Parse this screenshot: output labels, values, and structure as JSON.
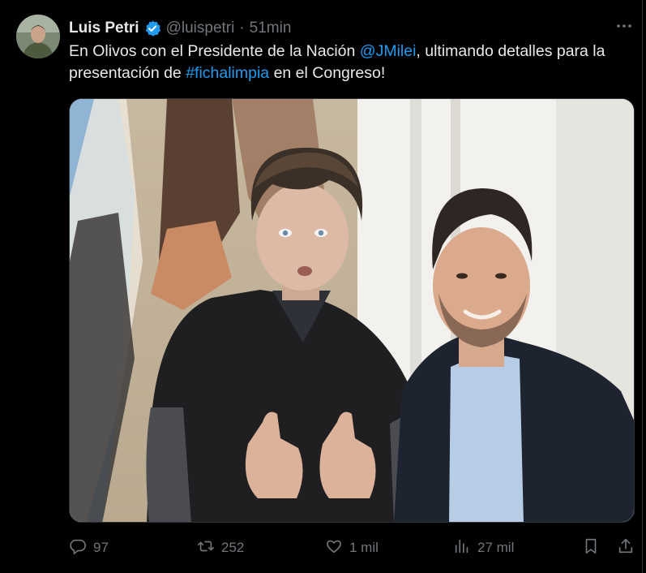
{
  "tweet": {
    "author_name": "Luis Petri",
    "handle": "@luispetri",
    "separator": "·",
    "time": "51min",
    "text_1": "En Olivos con el Presidente de la Nación ",
    "mention": "@JMilei",
    "text_2": ", ultimando detalles para la presentación de ",
    "hashtag": "#fichalimpia",
    "text_3": " en el Congreso!"
  },
  "actions": {
    "replies": "97",
    "reposts": "252",
    "likes": "1 mil",
    "views": "27 mil"
  },
  "colors": {
    "background": "#000000",
    "text": "#e7e9ea",
    "secondary": "#71767b",
    "link": "#1d9bf0",
    "border": "#2f3336"
  },
  "icons": {
    "verified": "verified-badge-icon",
    "more": "more-icon",
    "reply": "reply-icon",
    "repost": "repost-icon",
    "like": "heart-icon",
    "views": "views-icon",
    "bookmark": "bookmark-icon",
    "share": "share-icon"
  }
}
